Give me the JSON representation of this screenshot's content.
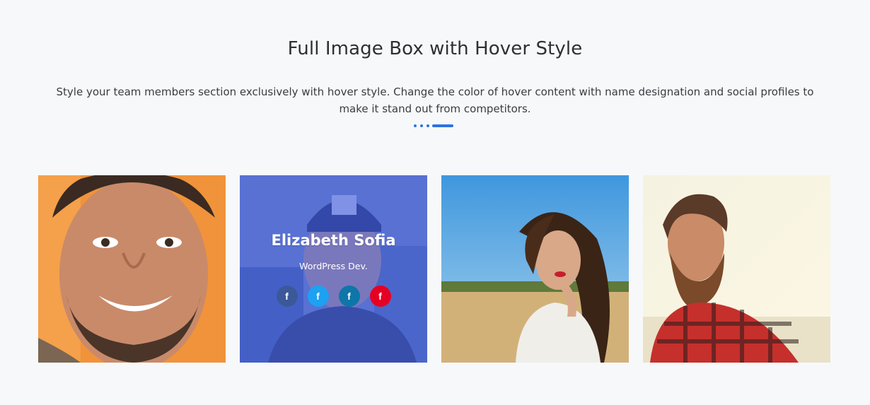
{
  "header": {
    "title": "Full Image Box with Hover Style",
    "description": "Style your team members section exclusively with hover style. Change the color of hover content with name designation and social profiles to make it stand out from competitors."
  },
  "accent_color": "#2a72e6",
  "overlay_color": "#405adc",
  "team": [
    {
      "photo": "smiling-man-orange-background"
    },
    {
      "photo": "man-in-cap-with-overlay",
      "name": "Elizabeth Sofia",
      "role": "WordPress Dev.",
      "socials": [
        {
          "icon": "facebook-icon",
          "glyph": "f",
          "color": "#3b5998"
        },
        {
          "icon": "facebook-icon",
          "glyph": "f",
          "color": "#1da1f2"
        },
        {
          "icon": "facebook-icon",
          "glyph": "f",
          "color": "#0e76a8"
        },
        {
          "icon": "facebook-icon",
          "glyph": "f",
          "color": "#e60023"
        }
      ]
    },
    {
      "photo": "curly-haired-woman-outdoors"
    },
    {
      "photo": "bearded-man-plaid-shirt"
    }
  ]
}
